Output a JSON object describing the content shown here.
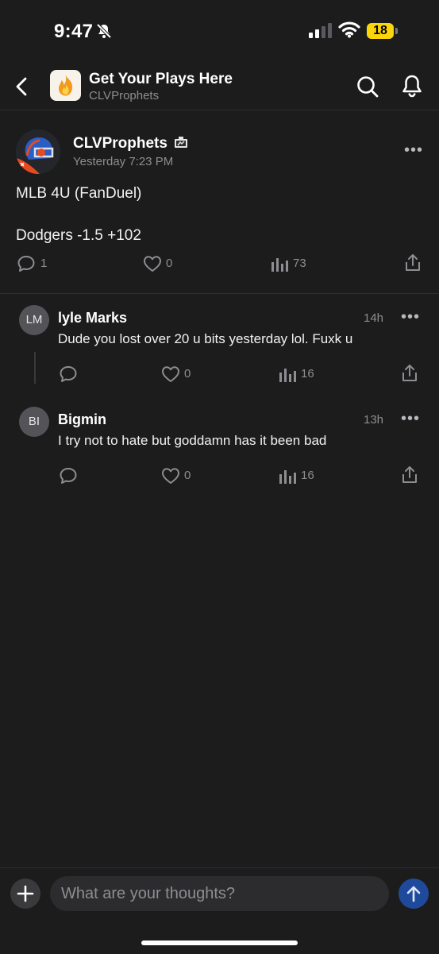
{
  "status_bar": {
    "time": "9:47",
    "battery": "18"
  },
  "header": {
    "title": "Get Your Plays Here",
    "subtitle": "CLVProphets"
  },
  "post": {
    "author": "CLVProphets",
    "timestamp": "Yesterday 7:23 PM",
    "lines": [
      "MLB 4U (FanDuel)",
      "Dodgers -1.5 +102"
    ],
    "comments": "1",
    "likes": "0",
    "views": "73"
  },
  "comments": [
    {
      "initials": "LM",
      "author": "lyle Marks",
      "time": "14h",
      "text": "Dude you lost over 20 u bits yesterday lol. Fuxk u",
      "likes": "0",
      "views": "16"
    },
    {
      "initials": "BI",
      "author": "Bigmin",
      "time": "13h",
      "text": "I try not to hate but goddamn has it been bad",
      "likes": "0",
      "views": "16"
    }
  ],
  "composer": {
    "placeholder": "What are your thoughts?"
  },
  "colors": {
    "background": "#1c1c1d",
    "battery": "#fdd60a",
    "send": "#1f4a9c",
    "muted": "#8e8e92"
  }
}
